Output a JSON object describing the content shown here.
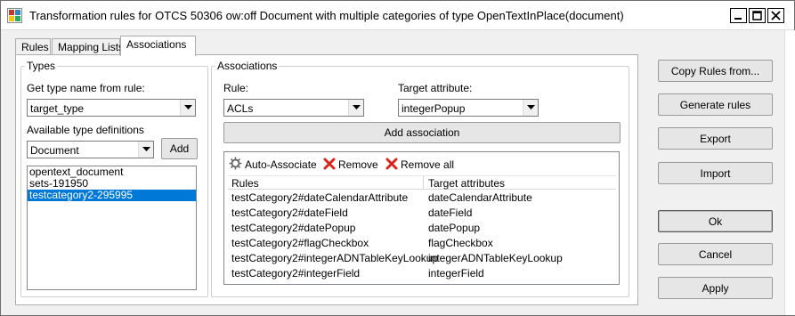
{
  "window": {
    "title": "Transformation rules for OTCS 50306 ow:off Document with multiple categories of type OpenTextInPlace(document)",
    "controls": [
      "minimize-icon",
      "maximize-icon",
      "close-icon"
    ]
  },
  "tabs": [
    {
      "label": "Rules",
      "active": false
    },
    {
      "label": "Mapping Lists",
      "active": false
    },
    {
      "label": "Associations",
      "active": true
    }
  ],
  "types": {
    "legend": "Types",
    "get_type_label": "Get type name from rule:",
    "get_type_value": "target_type",
    "available_label": "Available type definitions",
    "available_value": "Document",
    "add_label": "Add",
    "items": [
      "opentext_document",
      "sets-191950",
      "testcategory2-295995"
    ],
    "selected_index": 2
  },
  "associations": {
    "legend": "Associations",
    "rule_label": "Rule:",
    "rule_value": "ACLs",
    "target_attr_label": "Target attribute:",
    "target_attr_value": "integerPopup",
    "add_assoc_label": "Add association",
    "toolbar": {
      "auto_associate": "Auto-Associate",
      "remove": "Remove",
      "remove_all": "Remove all"
    },
    "columns": [
      "Rules",
      "Target attributes"
    ],
    "rows": [
      [
        "testCategory2#dateCalendarAttribute",
        "dateCalendarAttribute"
      ],
      [
        "testCategory2#dateField",
        "dateField"
      ],
      [
        "testCategory2#datePopup",
        "datePopup"
      ],
      [
        "testCategory2#flagCheckbox",
        "flagCheckbox"
      ],
      [
        "testCategory2#integerADNTableKeyLookup",
        "integerADNTableKeyLookup"
      ],
      [
        "testCategory2#integerField",
        "integerField"
      ]
    ]
  },
  "side_buttons": {
    "copy_rules": "Copy Rules from...",
    "generate_rules": "Generate rules",
    "export": "Export",
    "import": "Import",
    "ok": "Ok",
    "cancel": "Cancel",
    "apply": "Apply"
  },
  "colors": {
    "selection": "#0078d7",
    "remove_icon": "#d9261c",
    "window_bg": "#f0f0f0"
  }
}
